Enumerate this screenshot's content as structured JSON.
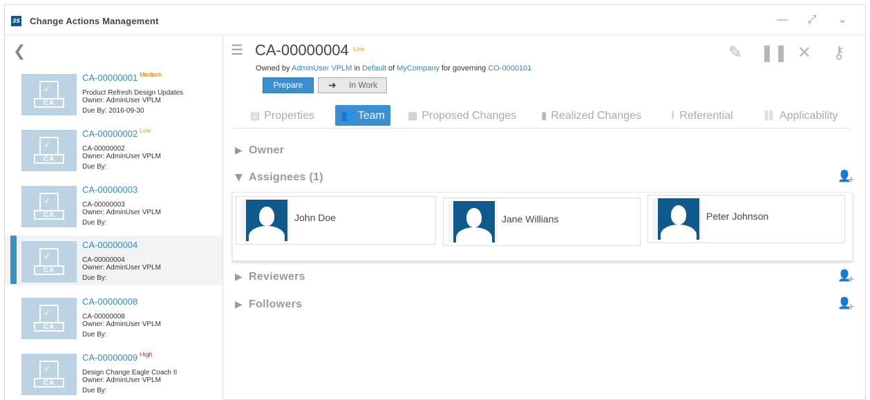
{
  "app": {
    "logo_text": "3S",
    "title": "Change Actions Management",
    "controls": {
      "minimize": "—",
      "expand": "⤢",
      "dropdown": "⌄"
    }
  },
  "sidebar": {
    "collapse_icon": "❮",
    "items": [
      {
        "name": "CA-00000001",
        "priority": "Medium",
        "line1": "Product Refresh Design Updates",
        "owner": "Owner: AdminUser VPLM",
        "due": "Due By: 2016-09-30",
        "selected": false
      },
      {
        "name": "CA-00000002",
        "priority": "Low",
        "line1": "CA-00000002",
        "owner": "Owner: AdminUser VPLM",
        "due": "Due By:",
        "selected": false
      },
      {
        "name": "CA-00000003",
        "priority": "",
        "line1": "CA-00000003",
        "owner": "Owner: AdminUser VPLM",
        "due": "Due By:",
        "selected": false
      },
      {
        "name": "CA-00000004",
        "priority": "",
        "line1": "CA-00000004",
        "owner": "Owner: AdminUser VPLM",
        "due": "Due By:",
        "selected": true
      },
      {
        "name": "CA-00000008",
        "priority": "",
        "line1": "CA-00000008",
        "owner": "Owner: AdminUser VPLM",
        "due": "Due By:",
        "selected": false
      },
      {
        "name": "CA-00000009",
        "priority": "High",
        "line1": "Design Change Eagle Coach II",
        "owner": "Owner: AdminUser VPLM",
        "due": "Due By:",
        "selected": false
      }
    ],
    "thumb_label": "CA"
  },
  "main": {
    "title": "CA-00000004",
    "priority": "Low",
    "owned_by": {
      "prefix": "Owned by",
      "user": "AdminUser VPLM",
      "in": "in",
      "collab": "Default",
      "of": "of",
      "company": "MyCompany",
      "for": "for governing",
      "co": "CO-0000101"
    },
    "state_current": "Prepare",
    "state_next": "In Work",
    "toolbar": [
      "edit-icon",
      "pause-icon",
      "close-icon",
      "key-icon"
    ],
    "tabs": [
      {
        "label": "Properties",
        "icon": "clipboard-icon",
        "active": false
      },
      {
        "label": "Team",
        "icon": "team-icon",
        "active": true
      },
      {
        "label": "Proposed Changes",
        "icon": "list-icon",
        "active": false
      },
      {
        "label": "Realized Changes",
        "icon": "bar-chart-icon",
        "active": false
      },
      {
        "label": "Referential",
        "icon": "paperclip-icon",
        "active": false
      },
      {
        "label": "Applicability",
        "icon": "link-icon",
        "active": false
      }
    ],
    "sections": {
      "owner": "Owner",
      "assignees": "Assignees (1)",
      "reviewers": "Reviewers",
      "followers": "Followers"
    },
    "assignees": [
      "John Doe",
      "Jane Willians",
      "Peter Johnson"
    ]
  },
  "colors": {
    "accent": "#3b8fd0",
    "link": "#2f8ac6",
    "avatar_bg": "#0f5a8d",
    "thumb_bg": "#bcd3e3"
  }
}
